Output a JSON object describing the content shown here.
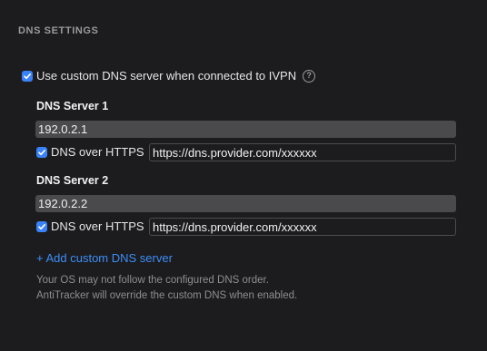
{
  "section": {
    "title": "DNS SETTINGS"
  },
  "custom_dns": {
    "checked": true,
    "label": "Use custom DNS server when connected to IVPN",
    "info_icon": "question-mark-circle-icon"
  },
  "servers": [
    {
      "title": "DNS Server 1",
      "ip": "192.0.2.1",
      "doh_checked": true,
      "doh_label": "DNS over HTTPS",
      "doh_url": "https://dns.provider.com/xxxxxx"
    },
    {
      "title": "DNS Server 2",
      "ip": "192.0.2.2",
      "doh_checked": true,
      "doh_label": "DNS over HTTPS",
      "doh_url": "https://dns.provider.com/xxxxxx"
    }
  ],
  "add_server_label": "+ Add custom DNS server",
  "notes": [
    "Your OS may not follow the configured DNS order.",
    "AntiTracker will override the custom DNS when enabled."
  ],
  "colors": {
    "background": "#1c1c1e",
    "accent": "#3a82f7",
    "link": "#3d8ef8",
    "input_fill": "#4a4a4d"
  }
}
